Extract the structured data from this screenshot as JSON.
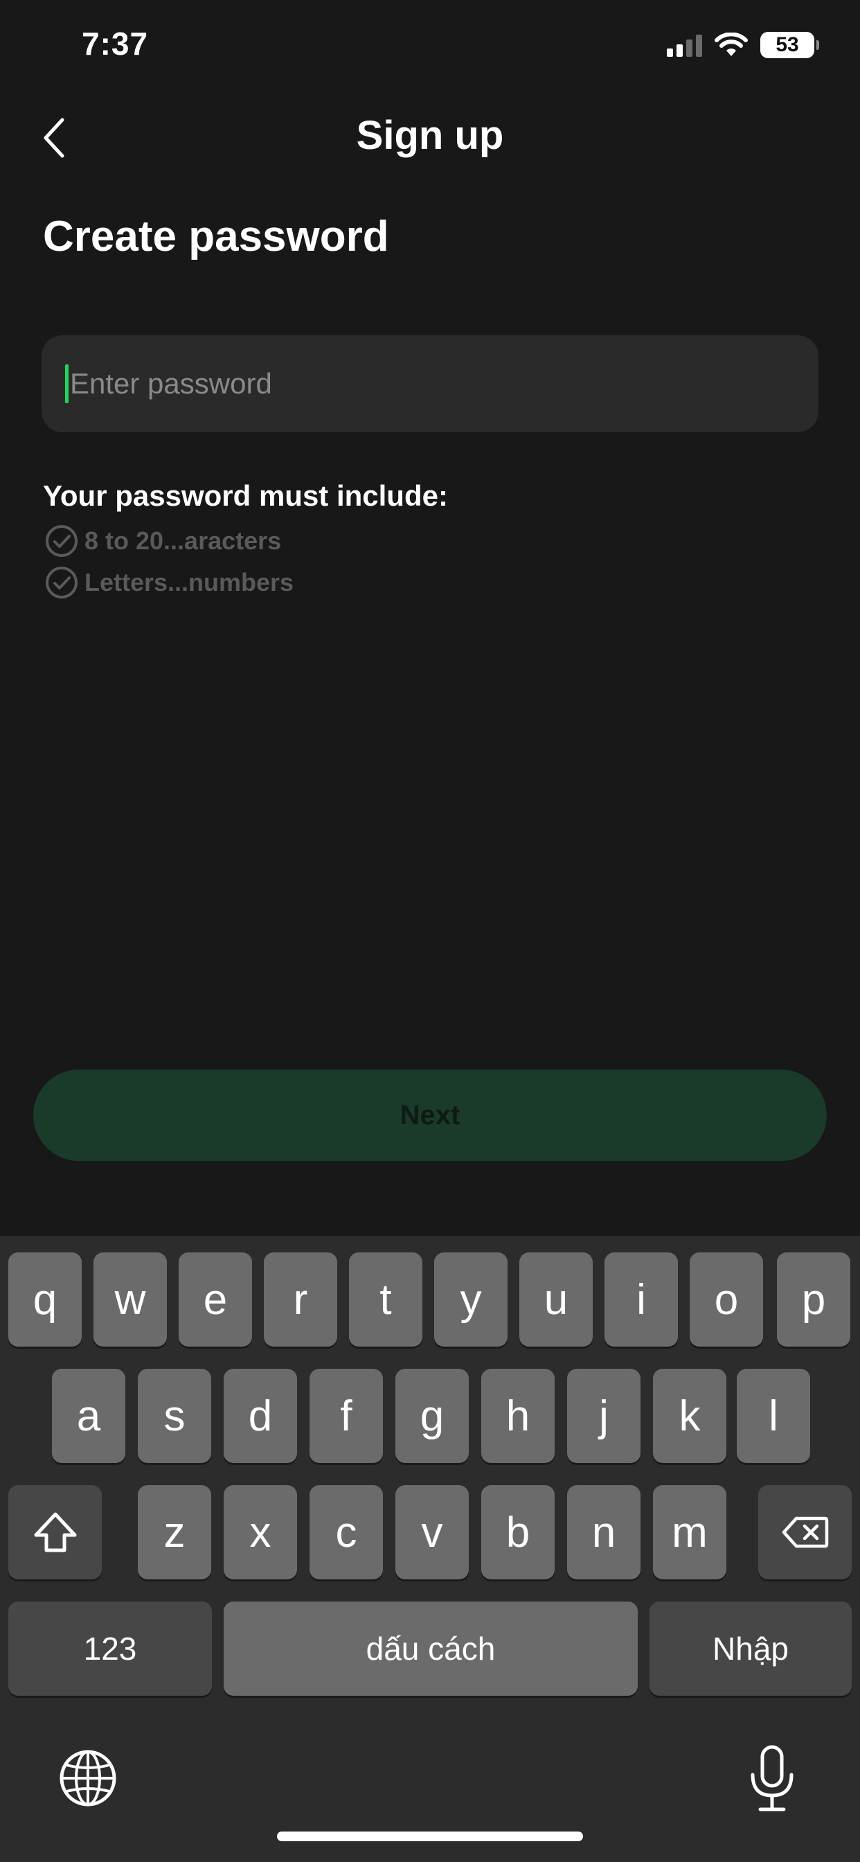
{
  "status_bar": {
    "time": "7:37",
    "battery": "53",
    "icons": [
      "signal-icon",
      "wifi-icon",
      "battery-icon"
    ]
  },
  "nav": {
    "title": "Sign up",
    "back_icon": "chevron-left-icon"
  },
  "heading": "Create password",
  "password_field": {
    "placeholder": "Enter password",
    "value": ""
  },
  "requirements": {
    "title": "Your password must include:",
    "items": [
      "8 to 20...aracters",
      "Letters...numbers"
    ]
  },
  "next_button": "Next",
  "keyboard": {
    "row1": [
      "q",
      "w",
      "e",
      "r",
      "t",
      "y",
      "u",
      "i",
      "o",
      "p"
    ],
    "row2": [
      "a",
      "s",
      "d",
      "f",
      "g",
      "h",
      "j",
      "k",
      "l"
    ],
    "row3": [
      "z",
      "x",
      "c",
      "v",
      "b",
      "n",
      "m"
    ],
    "numbers_key": "123",
    "space_key": "dấu cách",
    "return_key": "Nhập"
  },
  "colors": {
    "background": "#181818",
    "accent": "#1ed760",
    "button_disabled": "#1a3b2a"
  }
}
